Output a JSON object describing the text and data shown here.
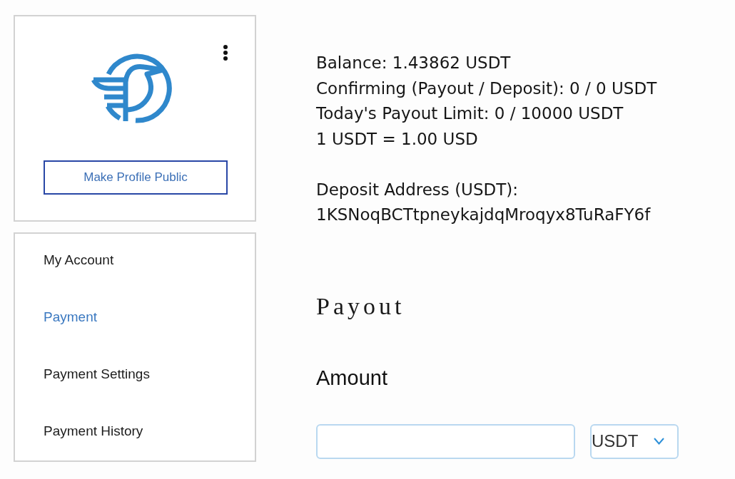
{
  "profile_card": {
    "make_public_button": "Make Profile Public"
  },
  "sidebar": {
    "items": [
      {
        "label": "My Account",
        "selected": false
      },
      {
        "label": "Payment",
        "selected": true
      },
      {
        "label": "Payment Settings",
        "selected": false
      },
      {
        "label": "Payment History",
        "selected": false
      }
    ]
  },
  "account_info": {
    "lines": [
      "Balance: 1.43862 USDT",
      "Confirming (Payout / Deposit): 0 / 0 USDT",
      "Today's Payout Limit: 0 / 10000 USDT",
      "1 USDT = 1.00 USD"
    ],
    "deposit_address_label": "Deposit Address (USDT):",
    "deposit_address": "1KSNoqBCTtpneykajdqMroqyx8TuRaFY6f"
  },
  "payout": {
    "heading": "Payout",
    "amount_label": "Amount",
    "currency_select": {
      "value": "USDT"
    }
  }
}
